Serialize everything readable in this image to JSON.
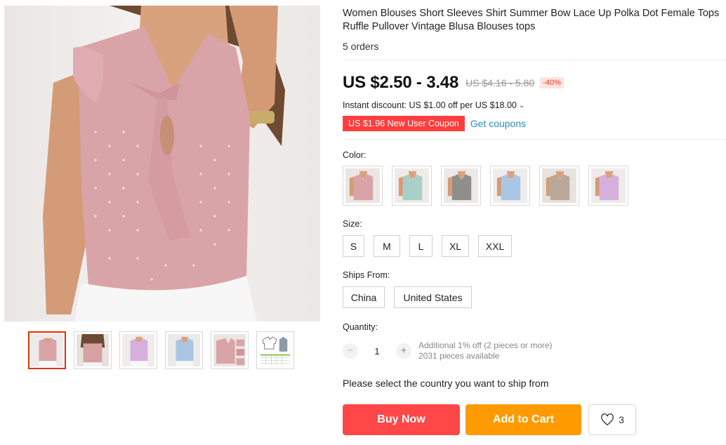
{
  "product": {
    "title": "Women Blouses Short Sleeves Shirt Summer Bow Lace Up Polka Dot Female Tops Ruffle Pullover Vintage Blusa Blouses tops",
    "orders": "5 orders"
  },
  "gallery": {
    "thumbnails": [
      "pink-front",
      "pink-side",
      "lilac",
      "light-blue",
      "pink-detail",
      "size-chart"
    ],
    "active_index": 0
  },
  "price": {
    "current": "US $2.50 - 3.48",
    "original": "US $4.16 - 5.80",
    "discount": "-40%"
  },
  "promo": {
    "instant_discount": "Instant discount: US $1.00 off per US $18.00",
    "coupon_label": "US $1.96 New User Coupon",
    "get_coupons": "Get coupons"
  },
  "color": {
    "label": "Color:",
    "options": [
      "pink",
      "mint",
      "grey",
      "light-blue",
      "khaki",
      "lilac"
    ]
  },
  "size": {
    "label": "Size:",
    "options": [
      "S",
      "M",
      "L",
      "XL",
      "XXL"
    ]
  },
  "ships_from": {
    "label": "Ships From:",
    "options": [
      "China",
      "United States"
    ]
  },
  "quantity": {
    "label": "Quantity:",
    "value": "1",
    "minus": "−",
    "plus": "+",
    "note1": "Additional 1% off (2 pieces or more)",
    "note2": "2031 pieces available"
  },
  "ship_message": "Please select the country you want to ship from",
  "actions": {
    "buy_now": "Buy Now",
    "add_to_cart": "Add to Cart",
    "wishlist_count": "3"
  },
  "colors": {
    "accent_red": "#ff4747",
    "accent_orange": "#ff9a00",
    "coupon_red": "#ff3d3d",
    "link_blue": "#2b8bb5",
    "pink": "#d9a4a8",
    "mint": "#a9cfc6",
    "grey": "#8e8f8a",
    "light_blue": "#a9c6e4",
    "khaki": "#b9a99a",
    "lilac": "#d6b0dd"
  }
}
